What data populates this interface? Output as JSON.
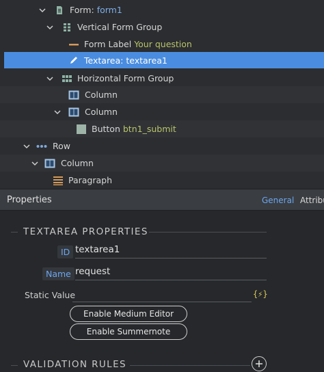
{
  "tree": {
    "rows": [
      {
        "label": "Form:",
        "sub": "form1"
      },
      {
        "label": "Vertical Form Group"
      },
      {
        "label": "Form Label",
        "sub": "Your question"
      },
      {
        "label": "Textarea: textarea1"
      },
      {
        "label": "Horizontal Form Group"
      },
      {
        "label": "Column"
      },
      {
        "label": "Column"
      },
      {
        "label": "Button",
        "sub": "btn1_submit"
      },
      {
        "label": "Row"
      },
      {
        "label": "Column"
      },
      {
        "label": "Paragraph"
      }
    ]
  },
  "properties": {
    "title": "Properties",
    "tabs": [
      "General",
      "Attribu"
    ],
    "section_title": "TEXTAREA PROPERTIES",
    "id_label": "ID",
    "id_value": "textarea1",
    "name_label": "Name",
    "name_value": "request",
    "static_label": "Static Value",
    "static_value": "",
    "static_bolt": "{⚡}",
    "btn_medium": "Enable Medium Editor",
    "btn_summernote": "Enable Summernote",
    "validation_title": "VALIDATION RULES"
  },
  "colors": {
    "accent": "#4a8de0",
    "link": "#6ca6ee",
    "sub_text": "#b9c46a",
    "bolt": "#d9c95a"
  }
}
